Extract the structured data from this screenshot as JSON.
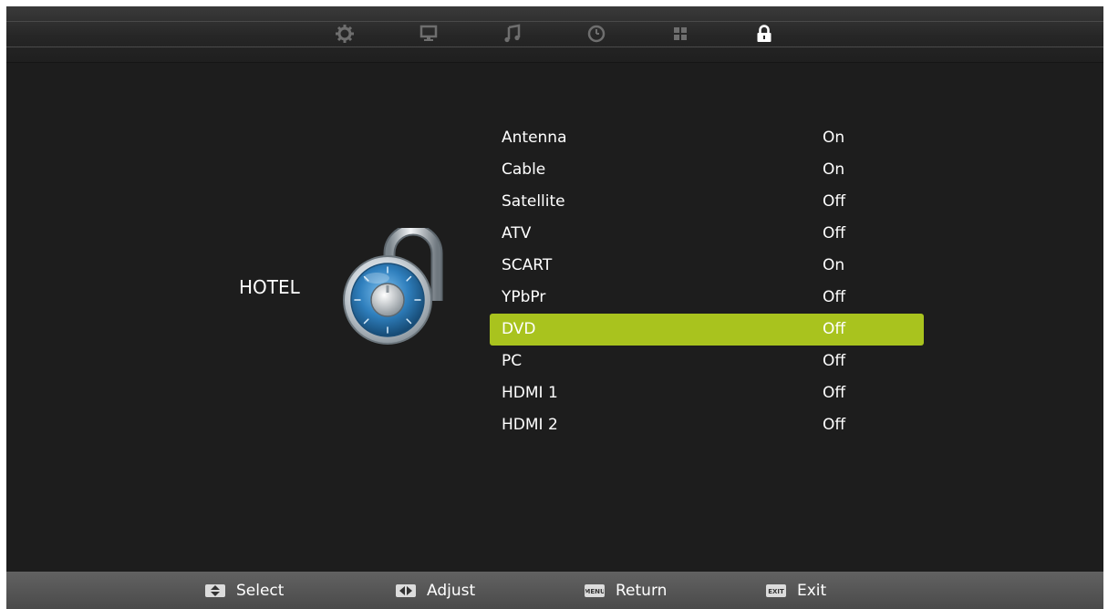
{
  "topbar": {
    "tabs": [
      {
        "icon": "gear-icon"
      },
      {
        "icon": "monitor-icon"
      },
      {
        "icon": "music-note-icon"
      },
      {
        "icon": "clock-icon"
      },
      {
        "icon": "grid-icon"
      },
      {
        "icon": "lock-icon",
        "active": true
      }
    ]
  },
  "hotel": {
    "title": "HOTEL",
    "icon": "combination-lock-icon"
  },
  "menu": {
    "items": [
      {
        "label": "Antenna",
        "value": "On"
      },
      {
        "label": "Cable",
        "value": "On"
      },
      {
        "label": "Satellite",
        "value": "Off"
      },
      {
        "label": "ATV",
        "value": "Off"
      },
      {
        "label": "SCART",
        "value": "On"
      },
      {
        "label": "YPbPr",
        "value": "Off"
      },
      {
        "label": "DVD",
        "value": "Off",
        "selected": true
      },
      {
        "label": "PC",
        "value": "Off"
      },
      {
        "label": "HDMI 1",
        "value": "Off"
      },
      {
        "label": "HDMI 2",
        "value": "Off"
      }
    ]
  },
  "footer": {
    "select_label": "Select",
    "adjust_label": "Adjust",
    "return_label": "Return",
    "return_key": "MENU",
    "exit_label": "Exit",
    "exit_key": "EXIT"
  },
  "colors": {
    "highlight": "#a9c31e",
    "background": "#1d1d1d"
  }
}
